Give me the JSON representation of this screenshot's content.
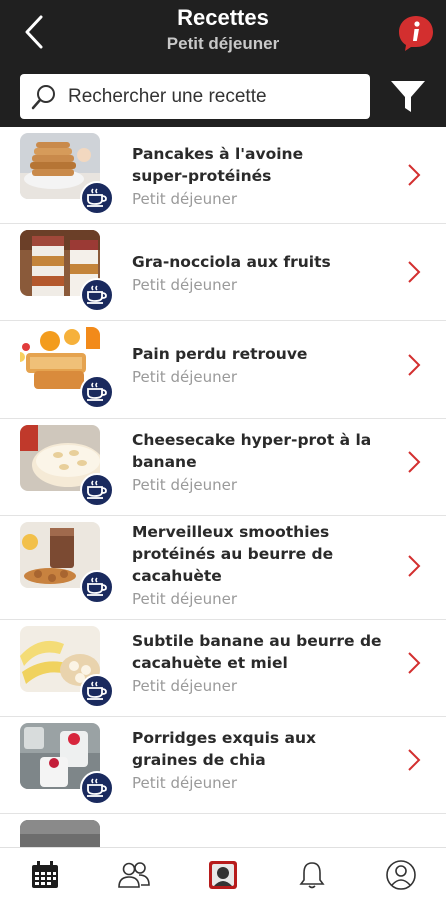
{
  "header": {
    "title": "Recettes",
    "subtitle": "Petit déjeuner",
    "back_icon": "chevron-left-icon",
    "info_icon": "info-icon",
    "bg_color": "#202020",
    "accent_color": "#d32f2f"
  },
  "search": {
    "placeholder": "Rechercher une recette",
    "icon": "search-icon",
    "filter_icon": "filter-icon"
  },
  "recipes": [
    {
      "title_lines": [
        "Pancakes à l'avoine",
        "super-protéinés"
      ],
      "category": "Petit déjeuner"
    },
    {
      "title_lines": [
        "Gra-nocciola aux fruits"
      ],
      "category": "Petit déjeuner"
    },
    {
      "title_lines": [
        "Pain perdu retrouve"
      ],
      "category": "Petit déjeuner"
    },
    {
      "title_lines": [
        "Cheesecake hyper-prot à la",
        "banane"
      ],
      "category": "Petit déjeuner"
    },
    {
      "title_lines": [
        "Merveilleux smoothies",
        "protéinés au beurre de",
        "cacahuète"
      ],
      "category": "Petit déjeuner"
    },
    {
      "title_lines": [
        "Subtile banane au beurre de",
        "cacahuète et miel"
      ],
      "category": "Petit déjeuner"
    },
    {
      "title_lines": [
        "Porridges exquis aux",
        "graines de chia"
      ],
      "category": "Petit déjeuner"
    }
  ],
  "badge_icon": "coffee-cup-icon",
  "bottom_nav": [
    {
      "name": "tab-calendar",
      "icon": "calendar-icon"
    },
    {
      "name": "tab-community",
      "icon": "people-icon"
    },
    {
      "name": "tab-home",
      "icon": "logo-icon"
    },
    {
      "name": "tab-notifications",
      "icon": "bell-icon"
    },
    {
      "name": "tab-profile",
      "icon": "user-icon"
    }
  ]
}
